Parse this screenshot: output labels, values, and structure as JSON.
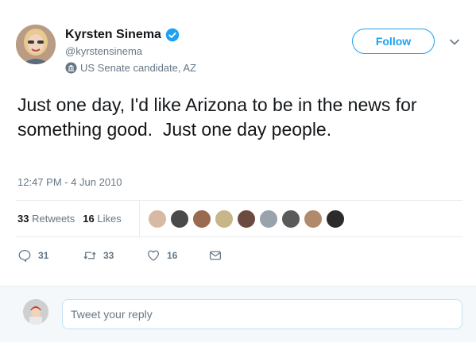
{
  "author": {
    "name": "Kyrsten Sinema",
    "handle": "@kyrstensinema",
    "label": "US Senate candidate, AZ",
    "verified": true
  },
  "follow_label": "Follow",
  "tweet_text": "Just one day, I'd like Arizona to be in the news for something good.  Just one day people.",
  "timestamp": "12:47 PM - 4 Jun 2010",
  "stats": {
    "retweets_count": "33",
    "retweets_label": "Retweets",
    "likes_count": "16",
    "likes_label": "Likes"
  },
  "liker_avatars": [
    "#d8b9a3",
    "#4a4a4a",
    "#9a6a4f",
    "#c8b68a",
    "#6d4a3f",
    "#9aa3ab",
    "#5a5a5a",
    "#b08a6a",
    "#2b2b2b"
  ],
  "actions": {
    "reply_count": "31",
    "retweet_count": "33",
    "like_count": "16"
  },
  "reply_placeholder": "Tweet your reply",
  "colors": {
    "accent": "#1da1f2",
    "muted": "#657786",
    "text": "#14171a",
    "border": "#e6ecf0"
  }
}
